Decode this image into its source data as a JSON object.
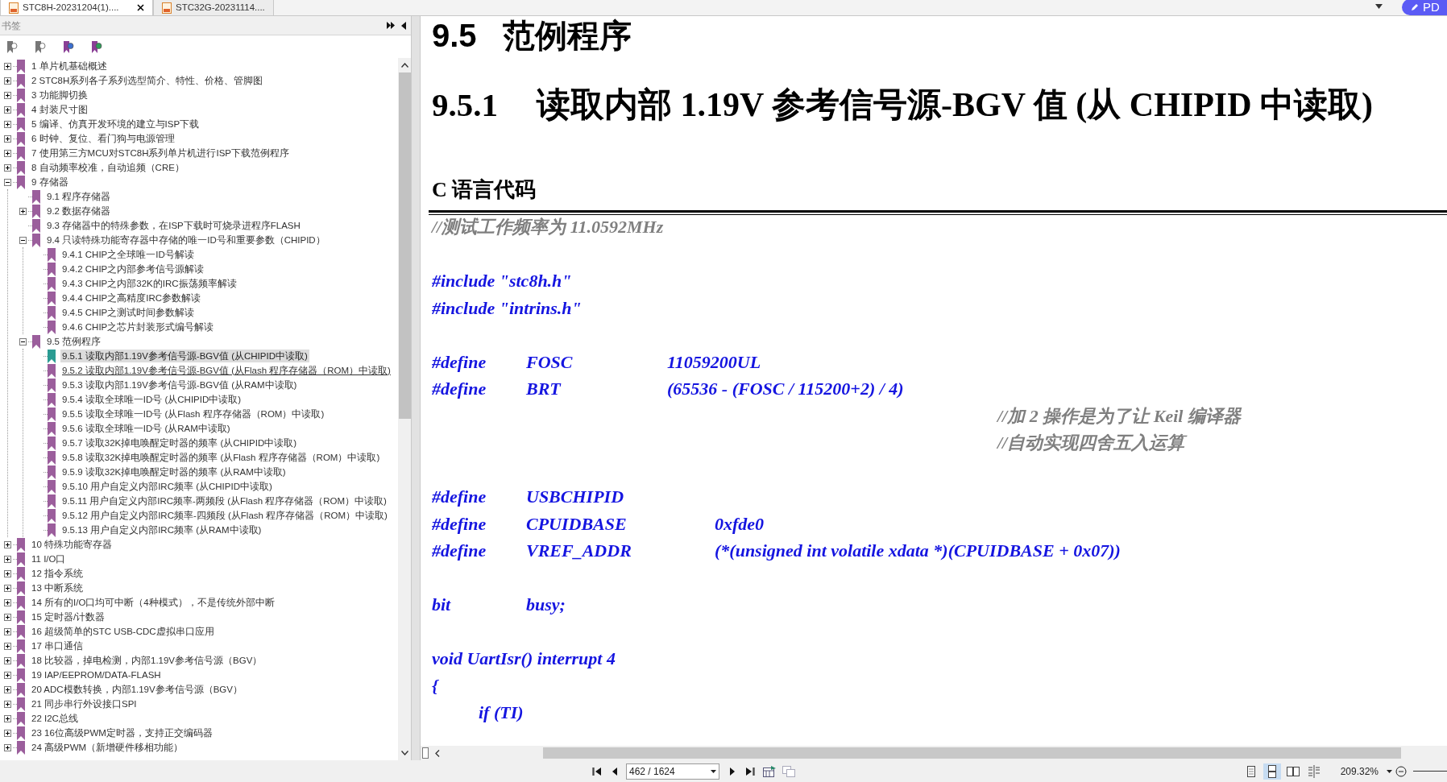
{
  "tabs": [
    {
      "label": "STC8H-20231204(1)....",
      "selected": true
    },
    {
      "label": "STC32G-20231114....",
      "selected": false
    }
  ],
  "top_right_button": {
    "label": "PD"
  },
  "bookmarks_panel": {
    "title": "书签",
    "tree": [
      {
        "label": "1 单片机基础概述",
        "selected": false,
        "hovered": false,
        "expanded": false
      },
      {
        "label": "2 STC8H系列各子系列选型简介、特性、价格、管脚图",
        "selected": false,
        "hovered": false,
        "expanded": false
      },
      {
        "label": "3 功能脚切换",
        "selected": false,
        "hovered": false,
        "expanded": false
      },
      {
        "label": "4 封装尺寸图",
        "selected": false,
        "hovered": false,
        "expanded": false
      },
      {
        "label": "5 编译、仿真开发环境的建立与ISP下载",
        "selected": false,
        "hovered": false,
        "expanded": false
      },
      {
        "label": "6 时钟、复位、看门狗与电源管理",
        "selected": false,
        "hovered": false,
        "expanded": false
      },
      {
        "label": "7 使用第三方MCU对STC8H系列单片机进行ISP下载范例程序",
        "selected": false,
        "hovered": false,
        "expanded": false
      },
      {
        "label": "8 自动频率校准，自动追频（CRE）",
        "selected": false,
        "hovered": false,
        "expanded": false
      },
      {
        "label": "9 存储器",
        "selected": false,
        "hovered": false,
        "expanded": true,
        "children": [
          {
            "label": "9.1 程序存储器",
            "selected": false,
            "hovered": false
          },
          {
            "label": "9.2 数据存储器",
            "selected": false,
            "hovered": false,
            "expanded": false
          },
          {
            "label": "9.3 存储器中的特殊参数，在ISP下载时可烧录进程序FLASH",
            "selected": false,
            "hovered": false
          },
          {
            "label": "9.4 只读特殊功能寄存器中存储的唯一ID号和重要参数（CHIPID）",
            "selected": false,
            "hovered": false,
            "expanded": true,
            "children": [
              {
                "label": "9.4.1 CHIP之全球唯一ID号解读",
                "selected": false,
                "hovered": false
              },
              {
                "label": "9.4.2 CHIP之内部参考信号源解读",
                "selected": false,
                "hovered": false
              },
              {
                "label": "9.4.3 CHIP之内部32K的IRC振荡频率解读",
                "selected": false,
                "hovered": false
              },
              {
                "label": "9.4.4 CHIP之高精度IRC参数解读",
                "selected": false,
                "hovered": false
              },
              {
                "label": "9.4.5 CHIP之测试时间参数解读",
                "selected": false,
                "hovered": false
              },
              {
                "label": "9.4.6 CHIP之芯片封装形式编号解读",
                "selected": false,
                "hovered": false
              }
            ]
          },
          {
            "label": "9.5 范例程序",
            "selected": false,
            "hovered": false,
            "expanded": true,
            "children": [
              {
                "label": "9.5.1 读取内部1.19V参考信号源-BGV值 (从CHIPID中读取)",
                "selected": true,
                "hovered": false
              },
              {
                "label": "9.5.2 读取内部1.19V参考信号源-BGV值 (从Flash 程序存储器（ROM）中读取)",
                "selected": false,
                "hovered": true
              },
              {
                "label": "9.5.3 读取内部1.19V参考信号源-BGV值 (从RAM中读取)",
                "selected": false,
                "hovered": false
              },
              {
                "label": "9.5.4 读取全球唯一ID号 (从CHIPID中读取)",
                "selected": false,
                "hovered": false
              },
              {
                "label": "9.5.5 读取全球唯一ID号 (从Flash 程序存储器（ROM）中读取)",
                "selected": false,
                "hovered": false
              },
              {
                "label": "9.5.6 读取全球唯一ID号 (从RAM中读取)",
                "selected": false,
                "hovered": false
              },
              {
                "label": "9.5.7 读取32K掉电唤醒定时器的频率 (从CHIPID中读取)",
                "selected": false,
                "hovered": false
              },
              {
                "label": "9.5.8 读取32K掉电唤醒定时器的频率 (从Flash 程序存储器（ROM）中读取)",
                "selected": false,
                "hovered": false
              },
              {
                "label": "9.5.9 读取32K掉电唤醒定时器的频率 (从RAM中读取)",
                "selected": false,
                "hovered": false
              },
              {
                "label": "9.5.10 用户自定义内部IRC频率 (从CHIPID中读取)",
                "selected": false,
                "hovered": false
              },
              {
                "label": "9.5.11 用户自定义内部IRC频率-两频段 (从Flash 程序存储器（ROM）中读取)",
                "selected": false,
                "hovered": false
              },
              {
                "label": "9.5.12 用户自定义内部IRC频率-四频段 (从Flash 程序存储器（ROM）中读取)",
                "selected": false,
                "hovered": false
              },
              {
                "label": "9.5.13 用户自定义内部IRC频率 (从RAM中读取)",
                "selected": false,
                "hovered": false
              }
            ]
          }
        ]
      },
      {
        "label": "10 特殊功能寄存器",
        "selected": false,
        "hovered": false,
        "expanded": false
      },
      {
        "label": "11 I/O口",
        "selected": false,
        "hovered": false,
        "expanded": false
      },
      {
        "label": "12 指令系统",
        "selected": false,
        "hovered": false,
        "expanded": false
      },
      {
        "label": "13 中断系统",
        "selected": false,
        "hovered": false,
        "expanded": false
      },
      {
        "label": "14 所有的I/O口均可中断（4种模式），不是传统外部中断",
        "selected": false,
        "hovered": false,
        "expanded": false
      },
      {
        "label": "15 定时器/计数器",
        "selected": false,
        "hovered": false,
        "expanded": false
      },
      {
        "label": "16 超级简单的STC USB-CDC虚拟串口应用",
        "selected": false,
        "hovered": false,
        "expanded": false
      },
      {
        "label": "17 串口通信",
        "selected": false,
        "hovered": false,
        "expanded": false
      },
      {
        "label": "18 比较器，掉电检测，内部1.19V参考信号源（BGV）",
        "selected": false,
        "hovered": false,
        "expanded": false
      },
      {
        "label": "19 IAP/EEPROM/DATA-FLASH",
        "selected": false,
        "hovered": false,
        "expanded": false
      },
      {
        "label": "20 ADC模数转换，内部1.19V参考信号源（BGV）",
        "selected": false,
        "hovered": false,
        "expanded": false
      },
      {
        "label": "21 同步串行外设接口SPI",
        "selected": false,
        "hovered": false,
        "expanded": false
      },
      {
        "label": "22 I2C总线",
        "selected": false,
        "hovered": false,
        "expanded": false
      },
      {
        "label": "23 16位高级PWM定时器，支持正交编码器",
        "selected": false,
        "hovered": false,
        "expanded": false
      },
      {
        "label": "24 高级PWM（新增硬件移相功能）",
        "selected": false,
        "hovered": false,
        "expanded": false
      }
    ]
  },
  "document": {
    "heading": {
      "number": "9.5",
      "title": "范例程序"
    },
    "subheading": {
      "number": "9.5.1",
      "title": "读取内部 1.19V 参考信号源-BGV 值 (从 CHIPID 中读取)"
    },
    "code_heading": "C 语言代码",
    "code_lines": [
      {
        "kind": "comment",
        "parts": [
          "//测试工作频率为 11.0592MHz"
        ]
      },
      {
        "kind": "gap"
      },
      {
        "kind": "plain",
        "parts": [
          "#include \"stc8h.h\""
        ]
      },
      {
        "kind": "plain",
        "parts": [
          "#include \"intrins.h\""
        ]
      },
      {
        "kind": "gap"
      },
      {
        "kind": "define",
        "parts": [
          "#define",
          "FOSC",
          "11059200UL"
        ]
      },
      {
        "kind": "define",
        "parts": [
          "#define",
          "BRT",
          "(65536 - (FOSC / 115200+2) / 4)"
        ]
      },
      {
        "kind": "side_comment",
        "parts": [
          "//加 2 操作是为了让 Keil 编译器"
        ]
      },
      {
        "kind": "side_comment",
        "parts": [
          "//自动实现四舍五入运算"
        ]
      },
      {
        "kind": "gap"
      },
      {
        "kind": "define_wide",
        "parts": [
          "#define",
          "USBCHIPID"
        ]
      },
      {
        "kind": "define_wide",
        "parts": [
          "#define",
          "CPUIDBASE",
          "0xfde0"
        ]
      },
      {
        "kind": "define_wide",
        "parts": [
          "#define",
          "VREF_ADDR",
          "(*(unsigned int volatile xdata *)(CPUIDBASE + 0x07))"
        ]
      },
      {
        "kind": "gap"
      },
      {
        "kind": "define",
        "parts": [
          "bit",
          "busy;"
        ]
      },
      {
        "kind": "gap"
      },
      {
        "kind": "plain",
        "parts": [
          "void UartIsr() interrupt 4"
        ]
      },
      {
        "kind": "plain",
        "parts": [
          "{"
        ]
      },
      {
        "kind": "indented",
        "parts": [
          "if (TI)"
        ]
      }
    ]
  },
  "status_bar": {
    "page_field": "462 / 1624",
    "zoom": "209.32%",
    "view_modes": [
      {
        "kind": "single",
        "selected": false
      },
      {
        "kind": "continuous",
        "selected": true
      },
      {
        "kind": "facing",
        "selected": false
      },
      {
        "kind": "cover",
        "selected": false
      }
    ]
  }
}
